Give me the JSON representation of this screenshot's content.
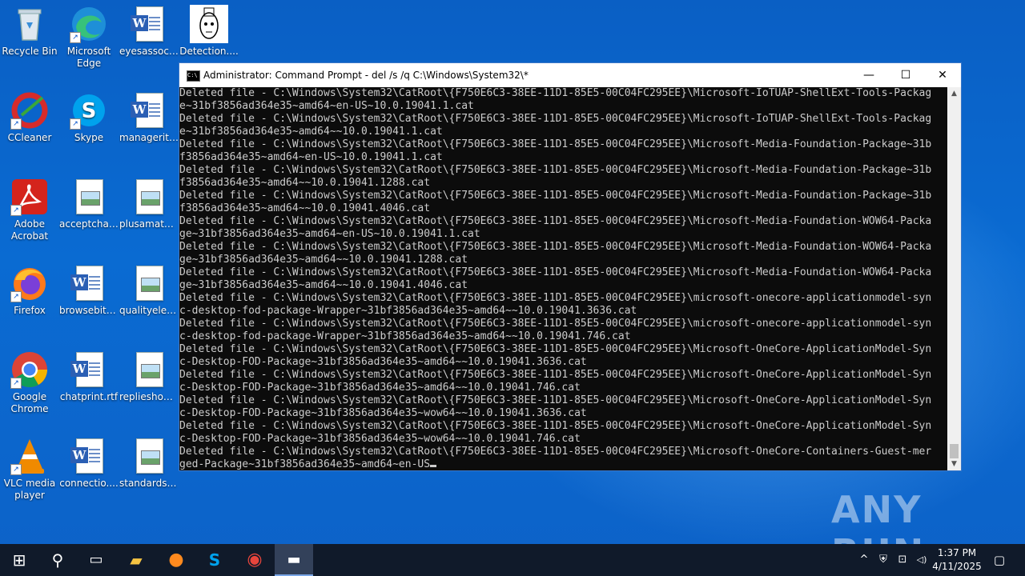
{
  "desktop": {
    "icons": [
      {
        "label": "Recycle Bin",
        "icon": "recycle-bin-icon"
      },
      {
        "label": "Microsoft Edge",
        "icon": "edge-icon"
      },
      {
        "label": "eyesassoci...",
        "icon": "word-doc-icon"
      },
      {
        "label": "Detection....",
        "icon": "detection-image-icon"
      },
      {
        "label": "CCleaner",
        "icon": "ccleaner-icon"
      },
      {
        "label": "Skype",
        "icon": "skype-icon"
      },
      {
        "label": "managerite...",
        "icon": "word-doc-icon"
      },
      {
        "label": "Adobe Acrobat",
        "icon": "acrobat-icon"
      },
      {
        "label": "acceptchat....",
        "icon": "image-file-icon"
      },
      {
        "label": "plusamate....",
        "icon": "image-file-icon"
      },
      {
        "label": "Firefox",
        "icon": "firefox-icon"
      },
      {
        "label": "browsebit.rtf",
        "icon": "word-doc-icon"
      },
      {
        "label": "qualityelec....",
        "icon": "image-file-icon"
      },
      {
        "label": "Google Chrome",
        "icon": "chrome-icon"
      },
      {
        "label": "chatprint.rtf",
        "icon": "word-doc-icon"
      },
      {
        "label": "replieshous....",
        "icon": "image-file-icon"
      },
      {
        "label": "VLC media player",
        "icon": "vlc-icon"
      },
      {
        "label": "connectio....",
        "icon": "word-doc-icon"
      },
      {
        "label": "standardsc....",
        "icon": "image-file-icon"
      }
    ]
  },
  "window": {
    "title": "Administrator: Command Prompt - del  /s /q C:\\Windows\\System32\\*",
    "icon_text": "C:\\",
    "minimize": "—",
    "maximize": "☐",
    "close": "✕",
    "lines": [
      "Deleted file - C:\\Windows\\System32\\CatRoot\\{F750E6C3-38EE-11D1-85E5-00C04FC295EE}\\Microsoft-IoTUAP-ShellExt-Tools-Packag",
      "e~31bf3856ad364e35~amd64~en-US~10.0.19041.1.cat",
      "Deleted file - C:\\Windows\\System32\\CatRoot\\{F750E6C3-38EE-11D1-85E5-00C04FC295EE}\\Microsoft-IoTUAP-ShellExt-Tools-Packag",
      "e~31bf3856ad364e35~amd64~~10.0.19041.1.cat",
      "Deleted file - C:\\Windows\\System32\\CatRoot\\{F750E6C3-38EE-11D1-85E5-00C04FC295EE}\\Microsoft-Media-Foundation-Package~31b",
      "f3856ad364e35~amd64~en-US~10.0.19041.1.cat",
      "Deleted file - C:\\Windows\\System32\\CatRoot\\{F750E6C3-38EE-11D1-85E5-00C04FC295EE}\\Microsoft-Media-Foundation-Package~31b",
      "f3856ad364e35~amd64~~10.0.19041.1288.cat",
      "Deleted file - C:\\Windows\\System32\\CatRoot\\{F750E6C3-38EE-11D1-85E5-00C04FC295EE}\\Microsoft-Media-Foundation-Package~31b",
      "f3856ad364e35~amd64~~10.0.19041.4046.cat",
      "Deleted file - C:\\Windows\\System32\\CatRoot\\{F750E6C3-38EE-11D1-85E5-00C04FC295EE}\\Microsoft-Media-Foundation-WOW64-Packa",
      "ge~31bf3856ad364e35~amd64~en-US~10.0.19041.1.cat",
      "Deleted file - C:\\Windows\\System32\\CatRoot\\{F750E6C3-38EE-11D1-85E5-00C04FC295EE}\\Microsoft-Media-Foundation-WOW64-Packa",
      "ge~31bf3856ad364e35~amd64~~10.0.19041.1288.cat",
      "Deleted file - C:\\Windows\\System32\\CatRoot\\{F750E6C3-38EE-11D1-85E5-00C04FC295EE}\\Microsoft-Media-Foundation-WOW64-Packa",
      "ge~31bf3856ad364e35~amd64~~10.0.19041.4046.cat",
      "Deleted file - C:\\Windows\\System32\\CatRoot\\{F750E6C3-38EE-11D1-85E5-00C04FC295EE}\\microsoft-onecore-applicationmodel-syn",
      "c-desktop-fod-package-Wrapper~31bf3856ad364e35~amd64~~10.0.19041.3636.cat",
      "Deleted file - C:\\Windows\\System32\\CatRoot\\{F750E6C3-38EE-11D1-85E5-00C04FC295EE}\\microsoft-onecore-applicationmodel-syn",
      "c-desktop-fod-package-Wrapper~31bf3856ad364e35~amd64~~10.0.19041.746.cat",
      "Deleted file - C:\\Windows\\System32\\CatRoot\\{F750E6C3-38EE-11D1-85E5-00C04FC295EE}\\Microsoft-OneCore-ApplicationModel-Syn",
      "c-Desktop-FOD-Package~31bf3856ad364e35~amd64~~10.0.19041.3636.cat",
      "Deleted file - C:\\Windows\\System32\\CatRoot\\{F750E6C3-38EE-11D1-85E5-00C04FC295EE}\\Microsoft-OneCore-ApplicationModel-Syn",
      "c-Desktop-FOD-Package~31bf3856ad364e35~amd64~~10.0.19041.746.cat",
      "Deleted file - C:\\Windows\\System32\\CatRoot\\{F750E6C3-38EE-11D1-85E5-00C04FC295EE}\\Microsoft-OneCore-ApplicationModel-Syn",
      "c-Desktop-FOD-Package~31bf3856ad364e35~wow64~~10.0.19041.3636.cat",
      "Deleted file - C:\\Windows\\System32\\CatRoot\\{F750E6C3-38EE-11D1-85E5-00C04FC295EE}\\Microsoft-OneCore-ApplicationModel-Syn",
      "c-Desktop-FOD-Package~31bf3856ad364e35~wow64~~10.0.19041.746.cat",
      "Deleted file - C:\\Windows\\System32\\CatRoot\\{F750E6C3-38EE-11D1-85E5-00C04FC295EE}\\Microsoft-OneCore-Containers-Guest-mer",
      "ged-Package~31bf3856ad364e35~amd64~en-US"
    ]
  },
  "taskbar": {
    "items": [
      {
        "icon": "start-icon",
        "glyph": "⊞"
      },
      {
        "icon": "search-icon",
        "glyph": "⚲"
      },
      {
        "icon": "task-view-icon",
        "glyph": "▭"
      },
      {
        "icon": "file-explorer-icon",
        "glyph": "▰"
      },
      {
        "icon": "firefox-taskbar-icon",
        "glyph": "●"
      },
      {
        "icon": "skype-taskbar-icon",
        "glyph": "S"
      },
      {
        "icon": "chrome-taskbar-icon",
        "glyph": "◉"
      },
      {
        "icon": "command-prompt-taskbar-icon",
        "glyph": "▬"
      }
    ],
    "tray": {
      "chevron": "^",
      "network": "⊡",
      "volume": "◁)",
      "notification": "▢"
    },
    "time": "1:37 PM",
    "date": "4/11/2025"
  },
  "watermark": "ANY RUN",
  "colors": {
    "desktop": "#0a6bd2",
    "console_bg": "#0c0c0c",
    "console_text": "#cccccc",
    "taskbar": "#101a2a"
  }
}
